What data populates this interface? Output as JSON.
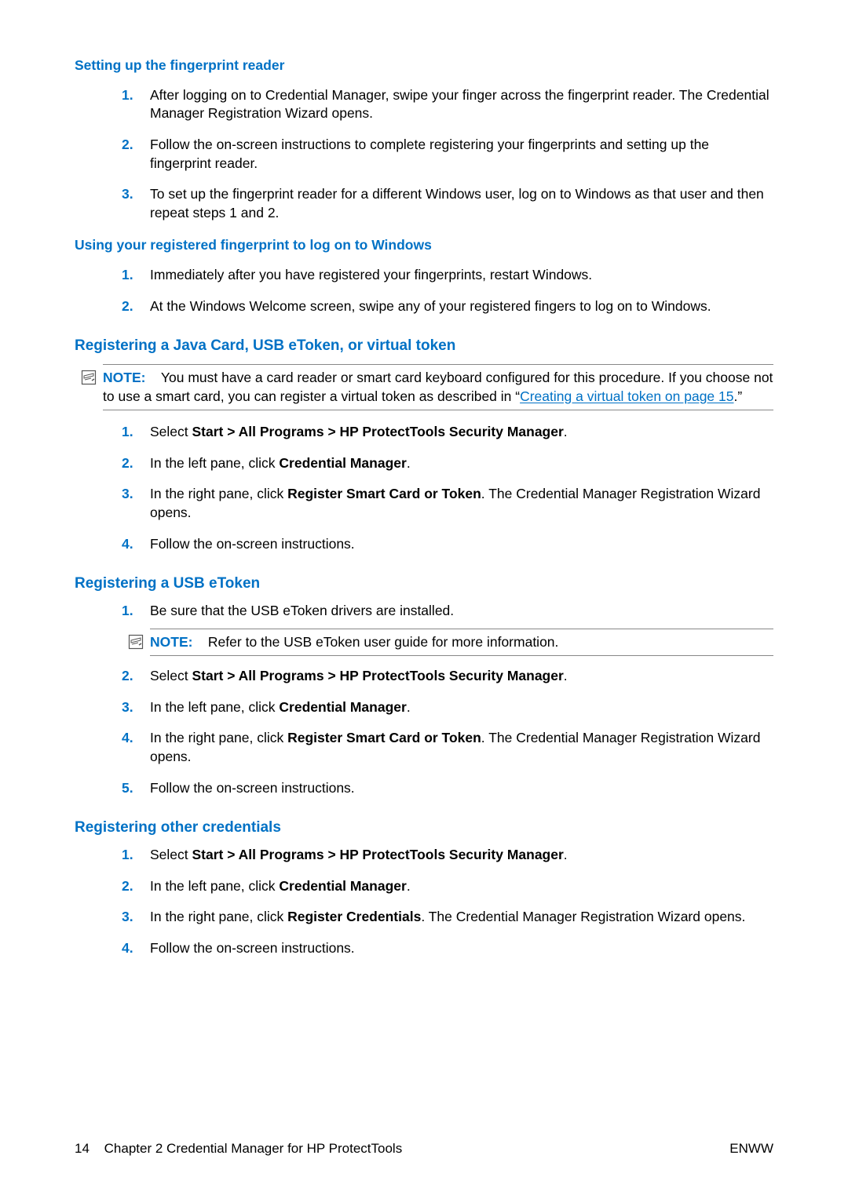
{
  "sec1": {
    "heading": "Setting up the fingerprint reader",
    "steps": [
      "After logging on to Credential Manager, swipe your finger across the fingerprint reader. The Credential Manager Registration Wizard opens.",
      "Follow the on-screen instructions to complete registering your fingerprints and setting up the fingerprint reader.",
      "To set up the fingerprint reader for a different Windows user, log on to Windows as that user and then repeat steps 1 and 2."
    ]
  },
  "sec2": {
    "heading": "Using your registered fingerprint to log on to Windows",
    "steps": [
      "Immediately after you have registered your fingerprints, restart Windows.",
      "At the Windows Welcome screen, swipe any of your registered fingers to log on to Windows."
    ]
  },
  "sec3": {
    "heading": "Registering a Java Card, USB eToken, or virtual token",
    "note": {
      "label": "NOTE:",
      "text_before_link": "You must have a card reader or smart card keyboard configured for this procedure. If you choose not to use a smart card, you can register a virtual token as described in “",
      "link_text": "Creating a virtual token on page 15",
      "text_after_link": ".”"
    },
    "step1_pre": "Select ",
    "step1_bold": "Start > All Programs > HP ProtectTools Security Manager",
    "step1_post": ".",
    "step2_pre": "In the left pane, click ",
    "step2_bold": "Credential Manager",
    "step2_post": ".",
    "step3_pre": "In the right pane, click ",
    "step3_bold": "Register Smart Card or Token",
    "step3_post": ". The Credential Manager Registration Wizard opens.",
    "step4": "Follow the on-screen instructions."
  },
  "sec4": {
    "heading": "Registering a USB eToken",
    "step1": "Be sure that the USB eToken drivers are installed.",
    "note": {
      "label": "NOTE:",
      "text": "Refer to the USB eToken user guide for more information."
    },
    "step2_pre": "Select ",
    "step2_bold": "Start > All Programs > HP ProtectTools Security Manager",
    "step2_post": ".",
    "step3_pre": "In the left pane, click ",
    "step3_bold": "Credential Manager",
    "step3_post": ".",
    "step4_pre": "In the right pane, click ",
    "step4_bold": "Register Smart Card or Token",
    "step4_post": ". The Credential Manager Registration Wizard opens.",
    "step5": "Follow the on-screen instructions."
  },
  "sec5": {
    "heading": "Registering other credentials",
    "step1_pre": "Select ",
    "step1_bold": "Start > All Programs > HP ProtectTools Security Manager",
    "step1_post": ".",
    "step2_pre": "In the left pane, click ",
    "step2_bold": "Credential Manager",
    "step2_post": ".",
    "step3_pre": "In the right pane, click ",
    "step3_bold": "Register Credentials",
    "step3_post": ". The Credential Manager Registration Wizard opens.",
    "step4": "Follow the on-screen instructions."
  },
  "footer": {
    "page_number": "14",
    "chapter": "Chapter 2   Credential Manager for HP ProtectTools",
    "lang": "ENWW"
  },
  "numbers": [
    "1.",
    "2.",
    "3.",
    "4.",
    "5."
  ]
}
